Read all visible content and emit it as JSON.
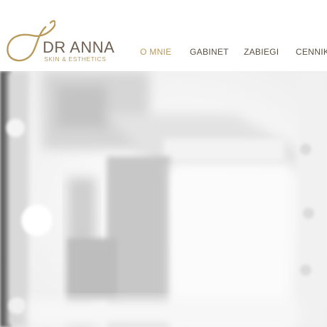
{
  "brand": {
    "name": "DR ANNA",
    "tagline": "SKIN & ESTHETICS"
  },
  "nav": {
    "items": [
      {
        "label": "O MNIE",
        "active": true
      },
      {
        "label": "GABINET",
        "active": false
      },
      {
        "label": "ZABIEGI",
        "active": false
      },
      {
        "label": "CENNIK",
        "active": false
      }
    ]
  },
  "colors": {
    "accent_gold": "#b99a5b",
    "nav_text": "#5a4f44",
    "logo_text": "#6f6253"
  },
  "icons": {
    "logo": "stylized-gold-loop-logo-icon"
  }
}
